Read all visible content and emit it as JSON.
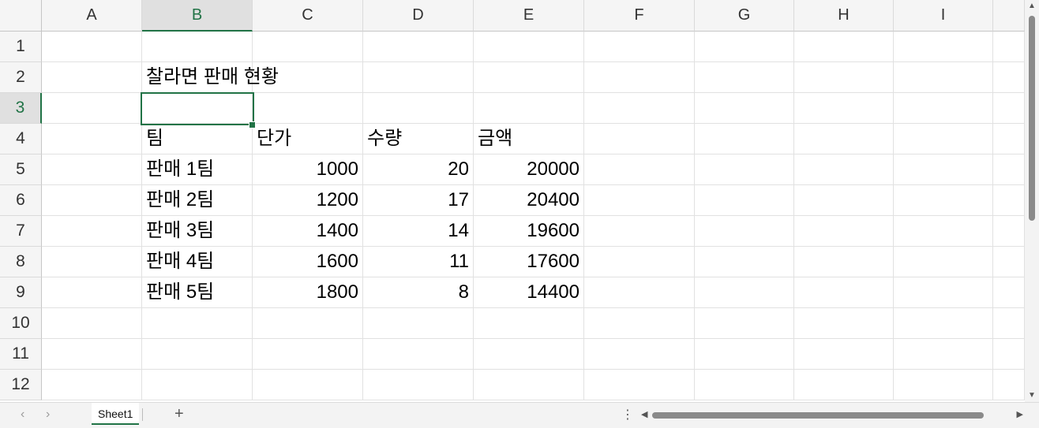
{
  "columns": [
    "A",
    "B",
    "C",
    "D",
    "E",
    "F",
    "G",
    "H",
    "I"
  ],
  "rows": [
    "1",
    "2",
    "3",
    "4",
    "5",
    "6",
    "7",
    "8",
    "9",
    "10",
    "11",
    "12"
  ],
  "selected": {
    "column": "B",
    "row": "3"
  },
  "title": "찰라면 판매 현황",
  "table": {
    "headers": [
      "팀",
      "단가",
      "수량",
      "금액"
    ],
    "rows": [
      [
        "판매 1팀",
        "1000",
        "20",
        "20000"
      ],
      [
        "판매 2팀",
        "1200",
        "17",
        "20400"
      ],
      [
        "판매 3팀",
        "1400",
        "14",
        "19600"
      ],
      [
        "판매 4팀",
        "1600",
        "11",
        "17600"
      ],
      [
        "판매 5팀",
        "1800",
        "8",
        "14400"
      ]
    ]
  },
  "sheet_tab": "Sheet1",
  "add_sheet_glyph": "+",
  "nav": {
    "prev_glyph": "‹",
    "next_glyph": "›"
  },
  "options_glyph": "⋮",
  "accent_color": "#217346"
}
